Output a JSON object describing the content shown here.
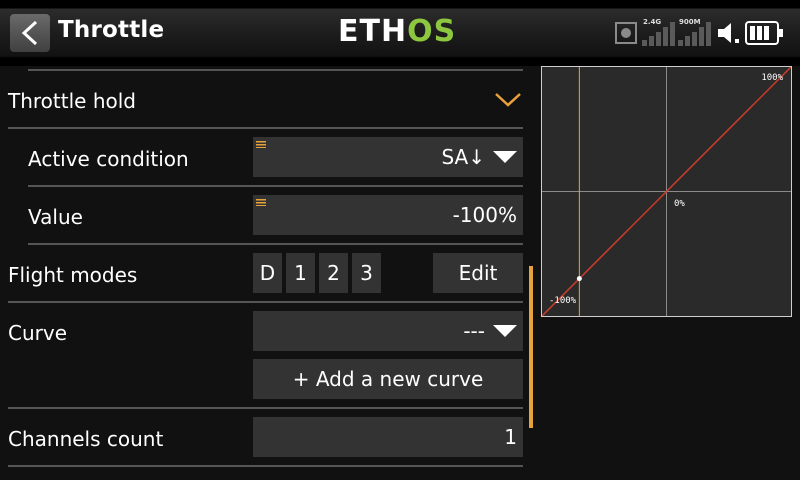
{
  "header": {
    "title": "Throttle",
    "logo_part1": "ETH",
    "logo_part2": "OS",
    "rf_band": "2.4G",
    "rf_freq": "900M"
  },
  "form": {
    "throttle_hold": {
      "label": "Throttle hold"
    },
    "active_condition": {
      "label": "Active condition",
      "value": "SA↓"
    },
    "value": {
      "label": "Value",
      "value": "-100%"
    },
    "flight_modes": {
      "label": "Flight modes",
      "modes": [
        "D",
        "1",
        "2",
        "3"
      ],
      "edit_label": "Edit"
    },
    "curve": {
      "label": "Curve",
      "value": "---",
      "add_label": "+ Add a new curve"
    },
    "channels_count": {
      "label": "Channels count",
      "value": "1"
    }
  },
  "chart_data": {
    "type": "line",
    "x": [
      -100,
      100
    ],
    "series": [
      {
        "values": [
          -100,
          100
        ]
      }
    ],
    "xlim": [
      -100,
      100
    ],
    "ylim": [
      -100,
      100
    ],
    "labels": {
      "max": "100%",
      "center": "0%",
      "min": "-100%"
    },
    "current_x": -70,
    "current_y": -70,
    "grid": true,
    "colors": {
      "curve": "#d23b2b",
      "cursor": "#e8a23c",
      "grid": "#8a8a8a"
    }
  },
  "colors": {
    "accent": "#e8a23c",
    "logo_green": "#8dc63f"
  }
}
